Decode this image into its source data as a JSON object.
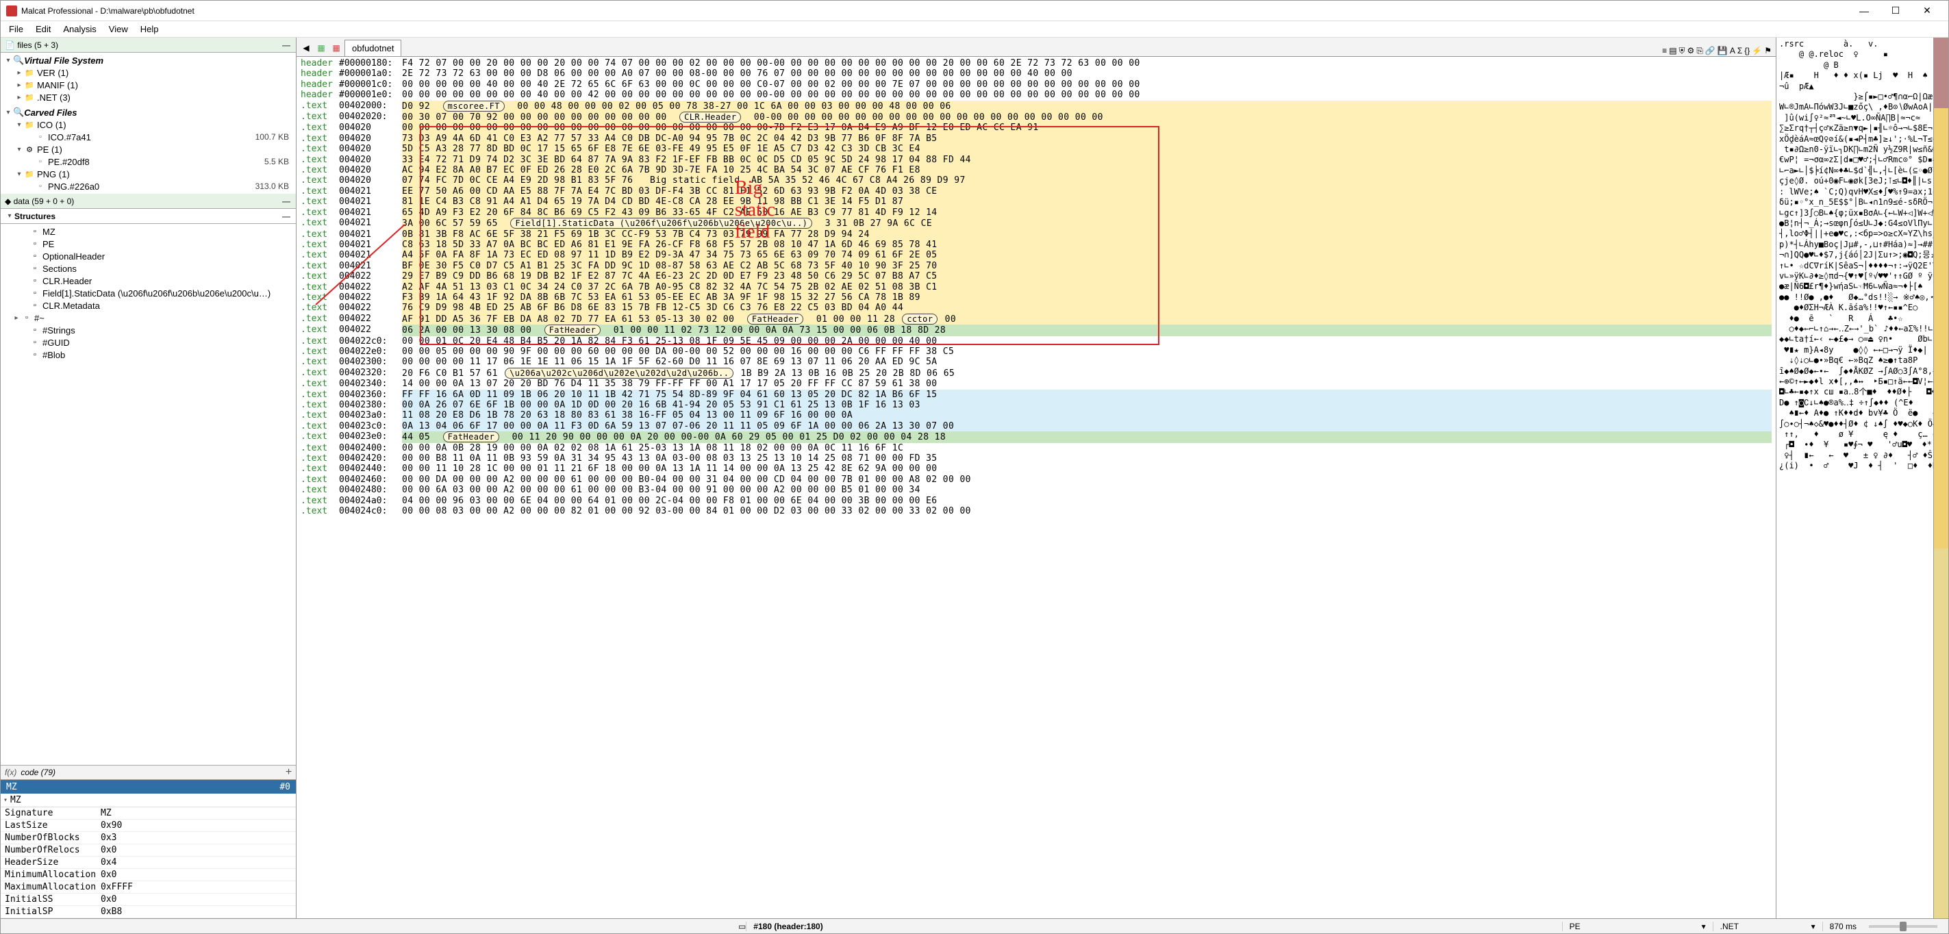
{
  "title": "Malcat Professional - D:\\malware\\pb\\obfudotnet",
  "menu": [
    "File",
    "Edit",
    "Analysis",
    "View",
    "Help"
  ],
  "files_header": "files (5 + 3)",
  "vfs": {
    "title": "Virtual File System",
    "items": [
      {
        "label": "VER (1)",
        "indent": 1,
        "expander": "▸",
        "icon": "folder"
      },
      {
        "label": "MANIF (1)",
        "indent": 1,
        "expander": "▸",
        "icon": "folder"
      },
      {
        "label": ".NET (3)",
        "indent": 1,
        "expander": "▸",
        "icon": "folder"
      }
    ]
  },
  "carved": {
    "title": "Carved Files",
    "items": [
      {
        "label": "ICO (1)",
        "indent": 1,
        "expander": "▾",
        "icon": "folder"
      },
      {
        "label": "ICO.#7a41",
        "indent": 2,
        "icon": "file",
        "size": "100.7 KB"
      },
      {
        "label": "PE (1)",
        "indent": 1,
        "expander": "▾",
        "icon": "gear"
      },
      {
        "label": "PE.#20df8",
        "indent": 2,
        "icon": "file",
        "size": "5.5 KB"
      },
      {
        "label": "PNG (1)",
        "indent": 1,
        "expander": "▾",
        "icon": "folder"
      },
      {
        "label": "PNG.#226a0",
        "indent": 2,
        "icon": "file",
        "size": "313.0 KB"
      }
    ]
  },
  "data_header": "data (59 + 0 + 0)",
  "structures": {
    "title": "Structures",
    "items": [
      {
        "label": "MZ",
        "indent": 1,
        "icon": "file"
      },
      {
        "label": "PE",
        "indent": 1,
        "icon": "file"
      },
      {
        "label": "OptionalHeader",
        "indent": 1,
        "icon": "file"
      },
      {
        "label": "Sections",
        "indent": 1,
        "icon": "file"
      },
      {
        "label": "CLR.Header",
        "indent": 1,
        "icon": "file"
      },
      {
        "label": "Field[1].StaticData (\\u206f\\u206f\\u206b\\u206e\\u200c\\u…)",
        "indent": 1,
        "icon": "file",
        "selected": false
      },
      {
        "label": "CLR.Metadata",
        "indent": 1,
        "icon": "file"
      },
      {
        "label": "#~",
        "indent": 0,
        "expander": "▸",
        "icon": "file"
      },
      {
        "label": "#Strings",
        "indent": 1,
        "icon": "file"
      },
      {
        "label": "#GUID",
        "indent": 1,
        "icon": "file"
      },
      {
        "label": "#Blob",
        "indent": 1,
        "icon": "file"
      }
    ]
  },
  "code_label": "code (79)",
  "mz_tab": {
    "name": "MZ",
    "index": "#0"
  },
  "mz_label": "MZ",
  "props": [
    {
      "k": "Signature",
      "v": "MZ"
    },
    {
      "k": "LastSize",
      "v": "0x90"
    },
    {
      "k": "NumberOfBlocks",
      "v": "0x3"
    },
    {
      "k": "NumberOfRelocs",
      "v": "0x0"
    },
    {
      "k": "HeaderSize",
      "v": "0x4"
    },
    {
      "k": "MinimumAllocation",
      "v": "0x0"
    },
    {
      "k": "MaximumAllocation",
      "v": "0xFFFF"
    },
    {
      "k": "InitialSS",
      "v": "0x0"
    },
    {
      "k": "InitialSP",
      "v": "0xB8"
    }
  ],
  "tab_label": "obfudotnet",
  "toolbar_icons": [
    "back-icon",
    "new-file-icon",
    "new-file-red-icon"
  ],
  "right_toolbar_icons": [
    "list-icon",
    "page-icon",
    "shield-icon",
    "gear-icon",
    "copy-icon",
    "link-icon",
    "save-icon",
    "text-a-icon",
    "func-icon",
    "braces-icon",
    "bolt-icon",
    "flag-icon"
  ],
  "hex_rows": [
    {
      "s": "header",
      "a": "#00000180:",
      "b": "F4 72 07 00 00 20 00 00 00 20 00 00 74 07 00 00 00 02 00 00 00 00-00 00 00 00 00 00 00 00 00 00 20 00 00 60 2E 72 73 72 63 00 00 00"
    },
    {
      "s": "header",
      "a": "#000001a0:",
      "b": "2E 72 73 72 63 00 00 00 D8 06 00 00 00 A0 07 00 00 08-00 00 00 76 07 00 00 00 00 00 00 00 00 00 00 00 00 00 00 40 00 00"
    },
    {
      "s": "header",
      "a": "#000001c0:",
      "b": "00 00 00 00 00 40 00 00 40 2E 72 65 6C 6F 63 00 00 0C 00 00 00 C0-07 00 00 02 00 00 00 7E 07 00 00 00 00 00 00 00 00 00 00 00 00 00"
    },
    {
      "s": "header",
      "a": "#000001e0:",
      "b": "00 00 00 00 00 00 00 00 40 00 00 42 00 00 00 00 00 00 00 00 00 00-00 00 00 00 00 00 00 00 00 00 00 00 00 00 00 00 00 00 00 00 00 00"
    },
    {
      "s": ".text",
      "a": "00402000:",
      "b": "D0 92  mscoree.FT  00 00 48 00 00 00 02 00 05 00 78 38-27 00 1C 6A 00 00 03 00 00 00 48 00 00 06",
      "hl": "hl"
    },
    {
      "s": ".text",
      "a": "00402020:",
      "b": "00 30 07 00 70 92 00 00 00 00 00 00 00 00 00 00  CLR.Header  00-00 00 00 00 00 00 00 00 00 00 00 00 00 00 00 00 00 00 00 00",
      "hl": "hl"
    },
    {
      "s": ".text",
      "a": "004020",
      "b": "00 00 00 00 00 00 00 00 00 00 00 00 00 00 00 00 00 00 00 00 00 00-7D F2 E3 17 0A B4 E9 A9 BF 12 E0 ED AC CC EA 91",
      "hl": "hl"
    },
    {
      "s": ".text",
      "a": "004020",
      "b": "73 D3 A9 4A 6D 41 C0 E3 A2 77 57 33 A4 C0 DB DC-A0 94 95 7B 0C 2C 04 42 D3 9B 77 B6 0F 8F 7A B5",
      "hl": "hl"
    },
    {
      "s": ".text",
      "a": "004020",
      "b": "5D C5 A3 28 77 8D BD 0C 17 15 65 6F E8 7E 6E 03-FE 49 95 E5 0F 1E A5 C7 D3 42 C3 3D CB 3C E4",
      "hl": "hl"
    },
    {
      "s": ".text",
      "a": "004020",
      "b": "33 E4 72 71 D9 74 D2 3C 3E BD 64 87 7A 9A 83 F2 1F-EF FB BB 0C 0C D5 CD 05 9C 5D 24 98 17 04 88 FD 44",
      "hl": "hl"
    },
    {
      "s": ".text",
      "a": "004020",
      "b": "AC 94 E2 8A A0 B7 EC 0F ED 26 28 E0 2C 6A 7B 9D 3D-7E FA 10 25 4C BA 54 3C 07 AE CF 76 F1 E8",
      "hl": "hl"
    },
    {
      "s": ".text",
      "a": "004020",
      "b": "07 74 FC 7D 0C CE A4 E9 2D 98 B1 83 5F 76   Big static field  AB 5A 35 52 46 4C 67 C8 A4 26 89 D9 97",
      "hl": "hl"
    },
    {
      "s": ".text",
      "a": "004021",
      "b": "EE 77 50 A6 00 CD AA E5 88 7F 7A E4 7C BD 03 DF-F4 3B CC 81 F1 52 6D 63 93 9B F2 0A 4D 03 38 CE",
      "hl": "hl"
    },
    {
      "s": ".text",
      "a": "004021",
      "b": "81 1E C4 B3 C8 91 A4 A1 D4 65 19 7A D4 CD BD 4E-C8 CA 28 EE 9B 11 98 BB C1 3E 14 F5 D1 87",
      "hl": "hl"
    },
    {
      "s": ".text",
      "a": "004021",
      "b": "65 4D A9 F3 E2 20 6F 84 8C B6 69 C5 F2 43 09 B6 33-65 4F C2 AE 50 16 AE B3 C9 77 81 4D F9 12 14",
      "hl": "hl"
    },
    {
      "s": ".text",
      "a": "004021",
      "b": "3A 00 6C 57 59 65  Field[1].StaticData (\\u206f\\u206f\\u206b\\u206e\\u200c\\u..)  3 31 0B 27 9A 6C CE",
      "hl": "hl"
    },
    {
      "s": ".text",
      "a": "004021",
      "b": "0B 81 3B F8 AC 6E 5F 38 21 F5 69 1B 3C CC-F9 53 7B C4 73 03 79 99 FA 77 28 D9 94 24",
      "hl": "hl"
    },
    {
      "s": ".text",
      "a": "004021",
      "b": "C8 63 18 5D 33 A7 0A BC BC ED A6 81 E1 9E FA 26-CF F8 68 F5 57 2B 08 10 47 1A 6D 46 69 85 78 41",
      "hl": "hl"
    },
    {
      "s": ".text",
      "a": "004021",
      "b": "A4 5F 0A FA 8F 1A 73 EC ED 08 97 11 1D B9 E2 D9-3A 47 34 75 73 65 6E 63 09 70 74 09 61 6F 2E 05",
      "hl": "hl"
    },
    {
      "s": ".text",
      "a": "004021",
      "b": "BF 0E 30 F5 C0 D7 C5 A1 B1 25 3C FA DD 9C 1D 08-87 58 63 AE C2 AB 5C 68 73 5F 40 10 90 3F 25 70",
      "hl": "hl"
    },
    {
      "s": ".text",
      "a": "004022",
      "b": "29 E7 B9 C9 DD B6 68 19 DB B2 1F E2 87 7C 4A E6-23 2C 2D 0D E7 F9 23 48 50 C6 29 5C 07 B8 A7 C5",
      "hl": "hl"
    },
    {
      "s": ".text",
      "a": "004022",
      "b": "A2 AF 4A 51 13 03 C1 0C 34 24 C0 37 2C 6A 7B A0-95 C8 82 32 4A 7C 54 75 2B 02 AE 02 51 08 3B C1",
      "hl": "hl"
    },
    {
      "s": ".text",
      "a": "004022",
      "b": "F3 B9 1A 64 43 1F 92 DA 8B 6B 7C 53 EA 61 53 05-EE EC AB 3A 9F 1F 98 15 32 27 56 CA 78 1B 89",
      "hl": "hl"
    },
    {
      "s": ".text",
      "a": "004022",
      "b": "76 C9 D9 98 4B ED 25 AB 6F B6 D8 6E 83 15 7B FB 12-C5 3D C6 C3 76 E8 22 C5 03 BD 04 A0 44",
      "hl": "hl"
    },
    {
      "s": ".text",
      "a": "004022",
      "b": "AF 91 DD A5 36 7F EB DA A8 02 7D 77 EA 61 53 05-13 30 02 00  FatHeader  01 00 00 11 28 cctor 00",
      "hl": "hl"
    },
    {
      "s": ".text",
      "a": "004022",
      "b": "06 2A 00 00 13 30 08 00  FatHeader  01 00 00 11 02 73 12 00 00 0A 0A 73 15 00 00 06 0B 18 8D 28",
      "hl": "hl2"
    },
    {
      "s": ".text",
      "a": "004022c0:",
      "b": "00 00 01 0C 20 E4 48 B4 B5 20 1A 82 84 F3 61 25-13 08 1F 09 5E 45 09 00 00 00 2A 00 00 00 40 00"
    },
    {
      "s": ".text",
      "a": "004022e0:",
      "b": "00 00 05 00 00 00 90 9F 00 00 00 60 00 00 00 DA 00-00 00 52 00 00 00 16 00 00 00 C6 FF FF FF 38 C5"
    },
    {
      "s": ".text",
      "a": "00402300:",
      "b": "00 00 00 00 11 17 06 1E 1E 11 06 15 1A 1F 5F 62-60 D0 11 16 07 8E 69 13 07 11 06 20 AA ED 9C 5A"
    },
    {
      "s": ".text",
      "a": "00402320:",
      "b": "20 F6 C0 B1 57 61",
      "field": "\\u206a\\u202c\\u206d\\u202e\\u202d\\u2d\\u206b..",
      "tail": "1B B9 2A 13 0B 16 0B 25 20 2B 8D 06 65"
    },
    {
      "s": ".text",
      "a": "00402340:",
      "b": "14 00 00 0A 13 07 20 20 BD 76 D4 11 35 38 79 FF-FF FF 00 A1 17 17 05 20 FF FF CC 87 59 61 38 00"
    },
    {
      "s": ".text",
      "a": "00402360:",
      "b": "FF FF 16 6A 0D 11 09 1B 06 20 10 11 1B 42 71 75 54 8D-89 9F 04 61 60 13 05 20 DC 82 1A B6 6F 15",
      "hl": "hl3"
    },
    {
      "s": ".text",
      "a": "00402380:",
      "b": "00 0A 26 07 6E 6F 1B 00 00 0A 1D 0D 00 20 16 6B 41-94 20 05 53 91 C1 61 25 13 0B 1F 16 13 03",
      "hl": "hl3"
    },
    {
      "s": ".text",
      "a": "004023a0:",
      "b": "11 08 20 E8 D6 1B 78 20 63 18 80 83 61 38 16-FF 05 04 13 00 11 09 6F 16 00 00 0A",
      "hl": "hl3"
    },
    {
      "s": ".text",
      "a": "004023c0:",
      "b": "0A 13 04 06 6F 17 00 00 0A 11 F3 0D 6A 59 13 07 07-06 20 11 11 05 09 6F 1A 00 00 06 2A 13 30 07 00",
      "hl": "hl3"
    },
    {
      "s": ".text",
      "a": "004023e0:",
      "b": "44 05  FatHeader  00 11 20 90 00 00 00 0A 20 00 00-00 0A 60 29 05 00 01 25 D0 02 00 00 04 28 18",
      "hl": "hl2"
    },
    {
      "s": ".text",
      "a": "00402400:",
      "b": "00 00 0A 0B 28 19 00 00 0A 02 02 08 1A 61 25-03 13 1A 08 11 18 02 00 00 0A 0C 11 16 6F 1C"
    },
    {
      "s": ".text",
      "a": "00402420:",
      "b": "00 00 B8 11 0A 11 0B 93 59 0A 31 34 95 43 13 0A 03-00 08 03 13 25 13 10 14 25 08 71 00 00 FD 35"
    },
    {
      "s": ".text",
      "a": "00402440:",
      "b": "00 00 11 10 28 1C 00 00 01 11 21 6F 18 00 00 0A 13 1A 11 14 00 00 0A 13 25 42 8E 62 9A 00 00 00"
    },
    {
      "s": ".text",
      "a": "00402460:",
      "b": "00 00 DA 00 00 00 A2 00 00 00 61 00 00 00 B0-04 00 00 31 04 00 00 CD 04 00 00 7B 01 00 00 A8 02 00 00"
    },
    {
      "s": ".text",
      "a": "00402480:",
      "b": "00 00 6A 03 00 00 A2 00 00 00 61 00 00 00 B3-04 00 00 91 00 00 00 A2 00 00 00 B5 01 00 00 34"
    },
    {
      "s": ".text",
      "a": "004024a0:",
      "b": "04 00 00 96 03 00 00 6E 04 00 00 64 01 00 00 2C-04 00 00 F8 01 00 00 6E 04 00 00 3B 00 00 00 E6"
    },
    {
      "s": ".text",
      "a": "004024c0:",
      "b": "00 00 08 03 00 00 A2 00 00 00 82 01 00 00 92 03-00 00 84 01 00 00 D2 03 00 00 33 02 00 00 33 02 00 00"
    }
  ],
  "ascii_lines": [
    ".rsrc        à.   v.",
    "    @ @.reloc  ♀     ▪",
    "         @ B",
    "|Æ▪    H   ♦ ♦ x(▪ Lj  ♥  H  ♠",
    "¬û  pÆ▲",
    "               }≥⌠▪►□•♂¶∩α⌐Ω|Ωæ",
    "W∟®JmA∟ΠówW3J∟■zőç\\ ,♦B⊙∖ØwAoA|↑",
    " ]û(wi∫♀²≈ꥮ◄~∟♥L.O∞ÑA∏B|≈¬c≈",
    "∑≥Σrq†┬┤ç♂κZä≥n▼q►|▪╢∟☼ô→¬∟$8E¬[≈é▪2D",
    "xÖḓèáA≈œQ♀⊘í&(▪◄P┤m♣]≥↓';·%L¬T≤<→▪¬≈→v±D",
    " t▪∂Ω≥n0-ÿï∟┐DK∏∟m2Ñ y½Z9R|w≤ñ&∟é'└γ",
    "€wP¦ =¬σα∞zΣ|d▪□♥♂;┤∟♂Rmc⊙° $D▪#♥MV8¶",
    "∟⌐a►∟│$╞í¢N∞♦♣∟$d`╣∟,┤∟[è∟(⊆◦●ØEW]→*¦↑[c",
    "çje◊Ø. oú+0◉F∟◉øk[ЗeJ;⊺≤∟◘♦║|∟srEvβ∟±&ÿ",
    ": lWVe;♠ `C;Q)qvH♥X≤♦∫♥%↑9=ax;1δ'ขlû",
    "δü;▪◦°x_n_5E$$°│B∟◂∩1∩9≤é-sδRÖ¬ú.w(]º••▪♦$",
    "∟gc↑]3∫○B∟♠{φ;üx▪ВσA∟{←∟W+◁]W+◁W+G¬mFi◄xA",
    "●B¦n┤¬_Á;→sœφn∫ó≤U∟J◆:G4≤oVlПy∟[üao.5",
    "┤,lo♂Φ┤||+e●♥c,:<бр=>o≥cX≈YZ\\hs_@□□◉?%▪",
    "p)*┤∟Áhy■Boç|Jµ#,-,⊔↑#Háa)≈]→##\\→°bŞíÅ",
    "¬∩]QQ●♥∟♦$7,j{áó│2J|Σu↑>;◉◘Q;믕₂",
    "↑∟• ☆dC∇ríK|SêaS¬│♦♦♦♦¬↑:→ÿQ2E'V[[X←ё",
    "v∟»ÿK∟∂♦≥◊πd¬{♥↑♥[º√♥♥'↑↑GØ º ÿqCa♠",
    "●æ|Ñ6◘£r¶♦}wήaS∟☜Ħ6∟wÑa≈¬♦├[♠",
    "●● !!Ø● ,●♦   Ø◆…°ds!!░→ ※♂♠◎,⋆▪♦♦пØ○ö$;i(",
    "   ●♦ØΣH¬ÆÀ K.āśa%!!♥↑←▪▪^E○   *   @○∫Eo",
    "  ♦●  ē   `   R   Á   ♣•☆",
    "  ○♦◆←⌐∟↑⌂→←‥Z←→'_b` ♪♦♦←aΣ%!!∟★← ≥¿±∑Є♦ZZ",
    "◆◆∟ta†í←‹ ←◆£◆→ ○=⏏ ♀n•     Øb∟♦&ºk←←→¬¬¬",
    " ♥∎★ m}A◂8y    ●◊◊ ←←□→¬ÿ Ï♦◆|     Ïε±↑Xa8₹",
    "  ⇣◊⇣○∟●∙»Bq€ ←»BqZ ♠≥●↑ta8P",
    "ȋ◆♠Ø◆Ø◆←∙←  ∫◆♦ÅKØZ →∫АØ○З∫А°8,←◉[◆ ⊙",
    "←⊕©↑←►◆♦l x♦[,,♠↔  ‣Б▪□↑ä←←◘V¦←←◉←∟◉← →",
    "◘∟♣←▪◆↑x cш ▪a‥8个■♦  ♦♦Ø♦├   ◘♦आ øo↓   ◄",
    "D● ↑◙∁↓∟♠●®a%‥‡ ÷↑∫◆♦♦ (^E♦    do     ←",
    "  ♠∎←♦ A♦● ↑K♦♦d♦ bv¥♣ Ö  ë●   ←   ğ",
    "∫○∙○┤¬♠◇&♥●♦♦┤Ø♦ ¢ ↓♠∫ ♦♥◆○K♦ Ö◆♂↑♥©♦в×←",
    " ↑↑,   ♦    ø ¥      ę ♦    ç… ė   ┤←",
    " ┌◘  ∙♦  ¥   ▪♥∮¬ ♥   '♂u◘♥  ♦* ┤u♀  ¦",
    " ♀┤  ∎←   ←  ♥   ± ♀ ∂♦   ┤♂ ♦Ŝ;*▪",
    "¿(i)  •  ♂    ♥J  ♦ ┤  '  □♦  ♦К♣ ♥* £♠ ♀3♦"
  ],
  "annotation": "Big static field",
  "status": {
    "pos": "#180 (header:180)",
    "type": "PE",
    "runtime": ".NET",
    "time": "870 ms"
  }
}
